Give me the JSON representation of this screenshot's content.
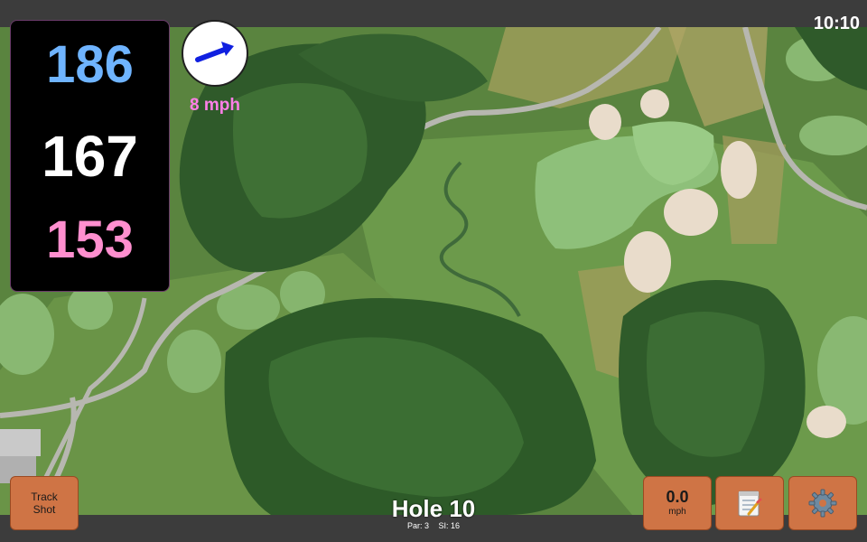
{
  "clock": "10:10",
  "distances": {
    "back": "186",
    "middle": "167",
    "front": "153",
    "colors": {
      "back": "#6fb4ff",
      "middle": "#ffffff",
      "front": "#ff8fcf"
    }
  },
  "wind": {
    "speed_label": "8 mph",
    "direction_icon": "wind-arrow-icon",
    "arrow_color": "#1020e0",
    "text_color": "#ff7fe8"
  },
  "hole": {
    "title": "Hole 10",
    "par": "Par: 3",
    "si": "SI: 16"
  },
  "buttons": {
    "track_shot_line1": "Track",
    "track_shot_line2": "Shot",
    "speed_value": "0.0",
    "speed_unit": "mph",
    "notes_icon": "notepad-icon",
    "settings_icon": "gear-icon",
    "color": "#cf7445"
  }
}
